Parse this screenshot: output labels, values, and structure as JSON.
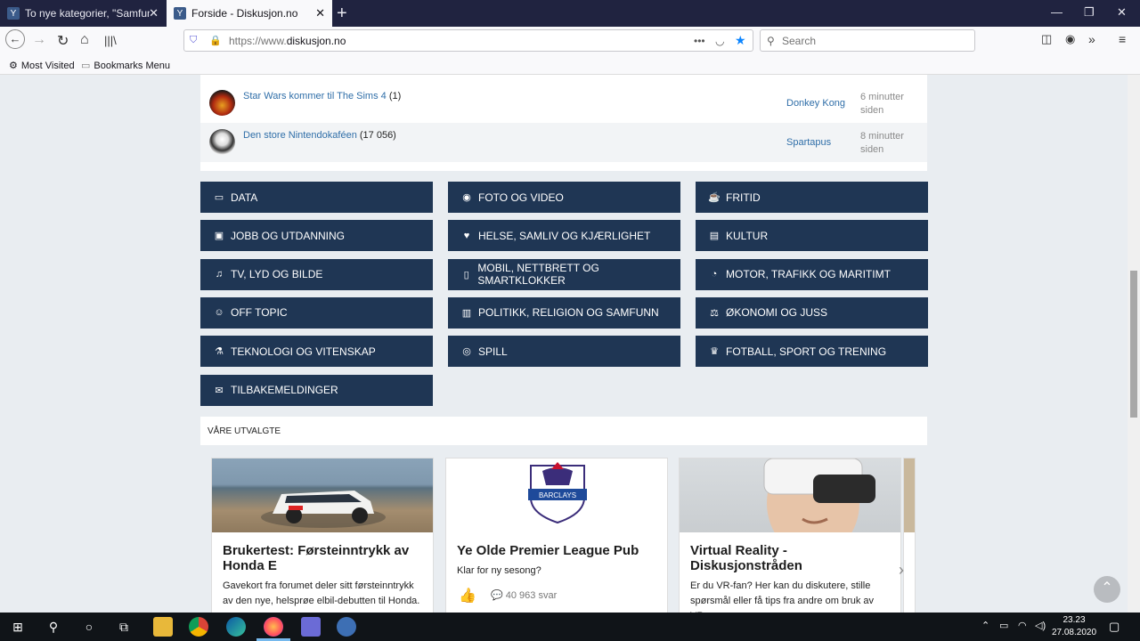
{
  "browser": {
    "tabs": [
      {
        "title": "To nye kategorier, \"Samfunn\" e"
      },
      {
        "title": "Forside - Diskusjon.no"
      }
    ],
    "url_scheme": "https://www.",
    "url_domain": "diskusjon.no",
    "search_placeholder": "Search",
    "bookmarks": [
      "Most Visited",
      "Bookmarks Menu"
    ]
  },
  "topics": [
    {
      "title": "Star Wars kommer til The Sims 4",
      "count": "(1)",
      "user": "Donkey Kong",
      "time": "6 minutter siden"
    },
    {
      "title": "Den store Nintendokaféen",
      "count": "(17 056)",
      "user": "Spartapus",
      "time": "8 minutter siden"
    }
  ],
  "categories": [
    {
      "label": "DATA",
      "icon": "monitor-icon",
      "glyph": "▭"
    },
    {
      "label": "FOTO OG VIDEO",
      "icon": "camera-icon",
      "glyph": "◉"
    },
    {
      "label": "FRITID",
      "icon": "coffee-icon",
      "glyph": "☕"
    },
    {
      "label": "JOBB OG UTDANNING",
      "icon": "briefcase-icon",
      "glyph": "▣"
    },
    {
      "label": "HELSE, SAMLIV OG KJÆRLIGHET",
      "icon": "heartbeat-icon",
      "glyph": "♥"
    },
    {
      "label": "KULTUR",
      "icon": "film-icon",
      "glyph": "▤"
    },
    {
      "label": "TV, LYD OG BILDE",
      "icon": "music-icon",
      "glyph": "♫"
    },
    {
      "label": "MOBIL, NETTBRETT OG SMARTKLOKKER",
      "icon": "mobile-icon",
      "glyph": "▯"
    },
    {
      "label": "MOTOR, TRAFIKK OG MARITIMT",
      "icon": "dashboard-icon",
      "glyph": "◔"
    },
    {
      "label": "OFF TOPIC",
      "icon": "smile-icon",
      "glyph": "☺"
    },
    {
      "label": "POLITIKK, RELIGION OG SAMFUNN",
      "icon": "building-icon",
      "glyph": "▥"
    },
    {
      "label": "ØKONOMI OG JUSS",
      "icon": "scale-icon",
      "glyph": "⚖"
    },
    {
      "label": "TEKNOLOGI OG VITENSKAP",
      "icon": "flask-icon",
      "glyph": "⚗"
    },
    {
      "label": "SPILL",
      "icon": "gamepad-icon",
      "glyph": "◎"
    },
    {
      "label": "FOTBALL, SPORT OG TRENING",
      "icon": "trophy-icon",
      "glyph": "♛"
    },
    {
      "label": "TILBAKEMELDINGER",
      "icon": "comments-icon",
      "glyph": "✉"
    }
  ],
  "featured": {
    "heading": "VÅRE UTVALGTE",
    "cards": [
      {
        "title": "Brukertest: Førsteinntrykk av Honda E",
        "text": "Gavekort fra forumet deler sitt førsteinntrykk av den nye, helsprøe elbil-debutten til Honda."
      },
      {
        "title": "Ye Olde Premier League Pub",
        "text": "Klar for ny sesong?",
        "replies": "40 963 svar",
        "logo_text": "BARCLAYS"
      },
      {
        "title": "Virtual Reality - Diskusjonstråden",
        "text": "Er du VR-fan? Her kan du diskutere, stille spørsmål eller få tips fra andre om bruk av VR"
      }
    ]
  },
  "taskbar": {
    "time": "23.23",
    "date": "27.08.2020"
  },
  "colors": {
    "category_bg": "#1f3654",
    "link": "#2f6ea8",
    "tabbar": "#202340"
  }
}
